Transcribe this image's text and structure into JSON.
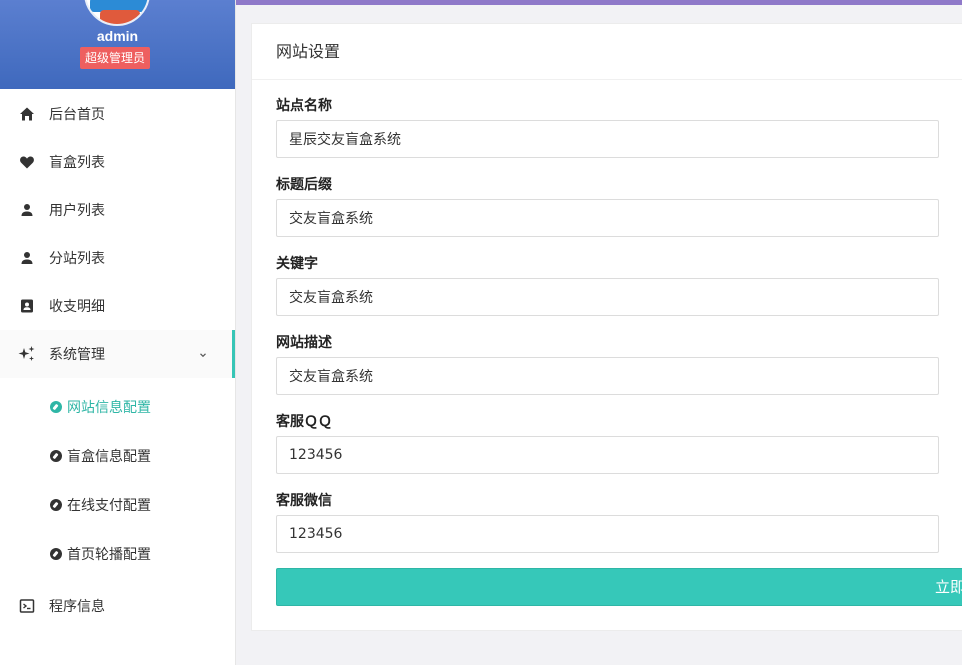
{
  "profile": {
    "username": "admin",
    "role_badge": "超级管理员"
  },
  "sidebar": {
    "items": [
      {
        "label": "后台首页",
        "icon": "home-icon"
      },
      {
        "label": "盲盒列表",
        "icon": "heart-icon"
      },
      {
        "label": "用户列表",
        "icon": "user-icon"
      },
      {
        "label": "分站列表",
        "icon": "user-icon"
      },
      {
        "label": "收支明细",
        "icon": "contacts-book-icon"
      },
      {
        "label": "系统管理",
        "icon": "sparkle-icon",
        "expanded": true
      }
    ],
    "sub_items": [
      {
        "label": "网站信息配置",
        "active": true
      },
      {
        "label": "盲盒信息配置"
      },
      {
        "label": "在线支付配置"
      },
      {
        "label": "首页轮播配置"
      }
    ],
    "bottom_item": {
      "label": "程序信息",
      "icon": "terminal-icon"
    }
  },
  "colors": {
    "accent": "#36c8b9",
    "header_gradient_top": "#5b7fd0",
    "badge": "#ee5f5f",
    "top_strip": "#8f79c9"
  },
  "card": {
    "title": "网站设置",
    "fields": [
      {
        "label": "站点名称",
        "value": "星辰交友盲盒系统"
      },
      {
        "label": "标题后缀",
        "value": "交友盲盒系统"
      },
      {
        "label": "关键字",
        "value": "交友盲盒系统"
      },
      {
        "label": "网站描述",
        "value": "交友盲盒系统"
      },
      {
        "label": "客服ＱＱ",
        "value": "123456"
      },
      {
        "label": "客服微信",
        "value": "123456"
      }
    ],
    "submit_label": "立即保存"
  }
}
